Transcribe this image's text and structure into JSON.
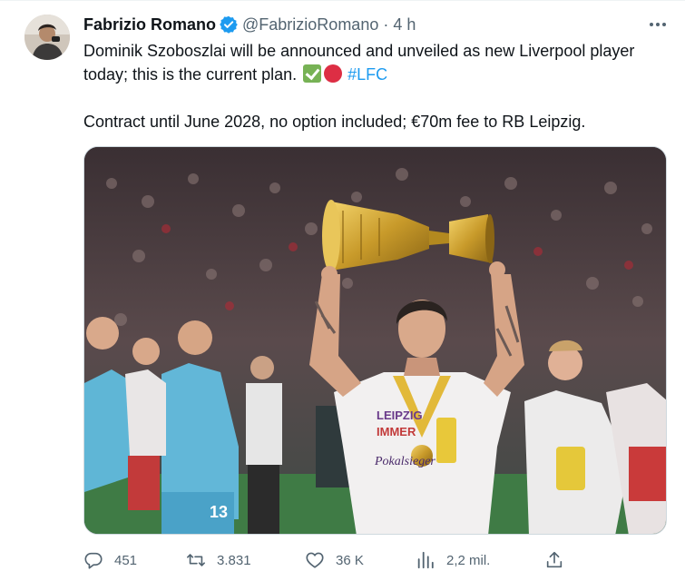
{
  "author": {
    "name": "Fabrizio Romano",
    "handle": "@FabrizioRomano",
    "separator": "·",
    "time": "4 h"
  },
  "tweet": {
    "line1": "Dominik Szoboszlai will be announced and unveiled as new Liverpool player today; this is the current plan.",
    "hashtag": "#LFC",
    "line2": "Contract until June 2028, no option included; €70m fee to RB Leipzig."
  },
  "media": {
    "shirt_text_1": "LEIPZIG",
    "shirt_text_2": "IMMER",
    "shirt_text_3": "Pokalsieger",
    "player_number": "13"
  },
  "actions": {
    "replies": "451",
    "retweets": "3.831",
    "likes": "36 K",
    "views": "2,2 mil."
  },
  "icons": [
    "verified-badge-icon",
    "more-icon",
    "check-emoji",
    "red-circle-emoji",
    "reply-icon",
    "retweet-icon",
    "like-icon",
    "views-icon",
    "share-icon"
  ],
  "colors": {
    "accent": "#1d9bf0",
    "muted": "#536471",
    "text": "#0f1419",
    "verified": "#1d9bf0"
  }
}
